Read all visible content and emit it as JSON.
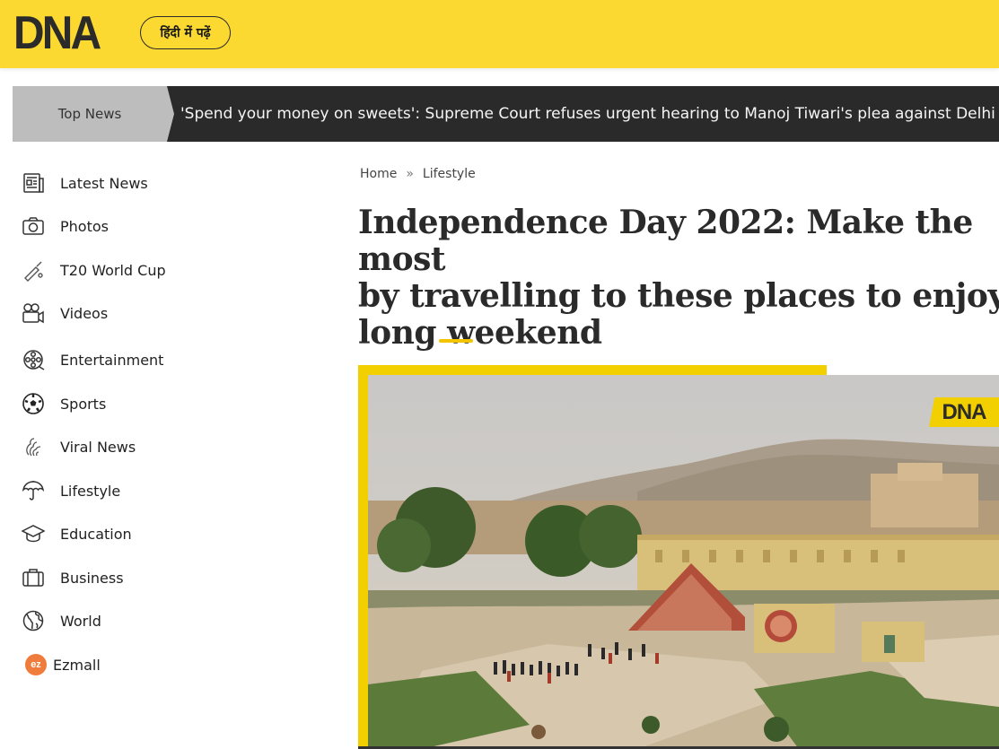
{
  "header": {
    "logo": "DNA",
    "hindi_button": "हिंदी में पढ़ें",
    "brand_color": "#fbd930"
  },
  "ticker": {
    "label": "Top News",
    "headline": "'Spend your money on sweets': Supreme Court refuses urgent hearing to Manoj Tiwari's plea against Delhi firecracker ban"
  },
  "sidebar": {
    "items": [
      {
        "label": "Latest News",
        "icon": "newspaper-icon"
      },
      {
        "label": "Photos",
        "icon": "camera-icon"
      },
      {
        "label": "T20 World Cup",
        "icon": "cricket-bat-icon"
      },
      {
        "label": "Videos",
        "icon": "video-camera-icon"
      },
      {
        "label": "Entertainment",
        "icon": "film-reel-icon"
      },
      {
        "label": "Sports",
        "icon": "football-icon"
      },
      {
        "label": "Viral News",
        "icon": "viral-icon"
      },
      {
        "label": "Lifestyle",
        "icon": "umbrella-icon"
      },
      {
        "label": "Education",
        "icon": "graduation-cap-icon"
      },
      {
        "label": "Business",
        "icon": "briefcase-icon"
      },
      {
        "label": "World",
        "icon": "globe-icon"
      },
      {
        "label": "Ezmall",
        "icon": "ezmall-icon",
        "badge": "ez"
      }
    ]
  },
  "breadcrumb": {
    "home": "Home",
    "separator": "»",
    "section": "Lifestyle"
  },
  "article": {
    "headline": "Independence Day 2022: Make the most of long weekend by travelling to these places to enjoy long weekend",
    "headline_visible": "Independence Day 2022: Make the mos­t by travelling to these places to enjoy long weekend",
    "image_badge": "DNA"
  }
}
